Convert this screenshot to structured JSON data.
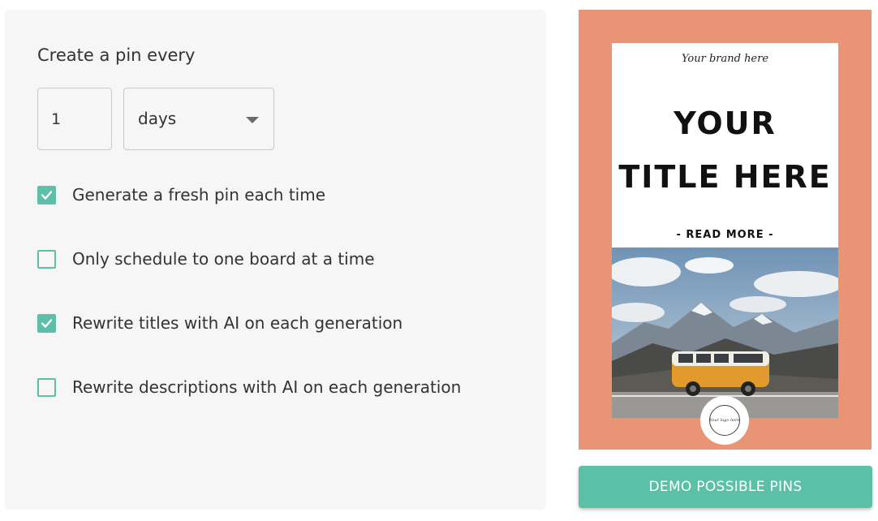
{
  "schedule": {
    "label": "Create a pin every",
    "interval_value": "1",
    "interval_unit": "days"
  },
  "options": [
    {
      "label": "Generate a fresh pin each time",
      "checked": true
    },
    {
      "label": "Only schedule to one board at a time",
      "checked": false
    },
    {
      "label": "Rewrite titles with AI on each generation",
      "checked": true
    },
    {
      "label": "Rewrite descriptions with AI on each generation",
      "checked": false
    }
  ],
  "pin_preview": {
    "brand": "Your brand here",
    "title_line1": "YOUR",
    "title_line2": "TITLE HERE",
    "cta": "- READ MORE -",
    "logo": "Your logo here",
    "background_color": "#ea9476"
  },
  "demo_button_label": "DEMO POSSIBLE PINS",
  "colors": {
    "accent": "#5cbfa8",
    "panel_bg": "#f6f6f6",
    "text": "#333333"
  }
}
